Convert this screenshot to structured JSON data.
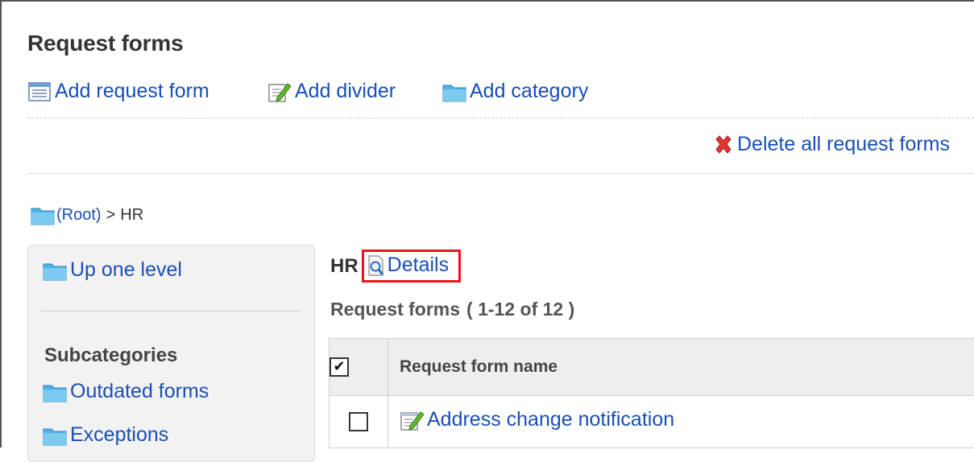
{
  "page": {
    "title": "Request forms"
  },
  "toolbar": {
    "add_request_form": {
      "label": "Add request form",
      "icon": "form-list-icon"
    },
    "add_divider": {
      "label": "Add divider",
      "icon": "edit-pencil-icon"
    },
    "add_category": {
      "label": "Add category",
      "icon": "folder-icon"
    }
  },
  "delete_all": {
    "label": "Delete all request forms",
    "icon": "red-x-icon"
  },
  "breadcrumb": {
    "root": "(Root)",
    "separator": ">",
    "current": "HR"
  },
  "sidebar": {
    "up_one_level": "Up one level",
    "subcategories_heading": "Subcategories",
    "subcategories": [
      "Outdated forms",
      "Exceptions"
    ]
  },
  "category": {
    "name": "HR",
    "details_label": "Details"
  },
  "list": {
    "count_prefix": "Request forms",
    "count_text": "( 1-12 of 12 )",
    "select_all_mark": "✔",
    "column_name": "Request form name",
    "rows": [
      {
        "name": "Address change notification",
        "checked": false
      }
    ]
  },
  "colors": {
    "link": "#1a4fb5",
    "highlight_box": "#e8161d",
    "folder": "#4fb2e6"
  }
}
